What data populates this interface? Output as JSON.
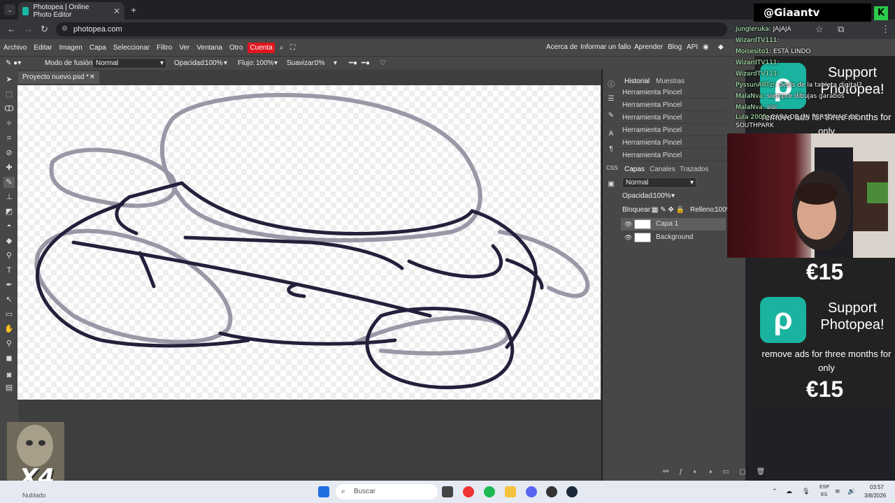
{
  "browser": {
    "tab_title": "Photopea | Online Photo Editor",
    "tab_close": "✕",
    "new_tab": "+",
    "url": "photopea.com"
  },
  "menu": {
    "items": [
      "Archivo",
      "Editar",
      "Imagen",
      "Capa",
      "Seleccionar",
      "Filtro",
      "Ver",
      "Ventana",
      "Otro"
    ],
    "account": "Cuenta",
    "right_items": [
      "Acerca de",
      "Informar un fallo",
      "Aprender",
      "Blog",
      "API"
    ]
  },
  "options": {
    "blend_label": "Modo de fusión:",
    "blend_value": "Normal",
    "opacity_label": "Opacidad:",
    "opacity_value": "100%",
    "flow_label": "Flujo:",
    "flow_value": "100%",
    "smooth_label": "Suavizar:",
    "smooth_value": "0%"
  },
  "document": {
    "tab_name": "Proyecto nuevo.psd *",
    "close": "✕"
  },
  "history": {
    "tabs": [
      "Historial",
      "Muestras"
    ],
    "items": [
      "Herramienta Pincel",
      "Herramienta Pincel",
      "Herramienta Pincel",
      "Herramienta Pincel",
      "Herramienta Pincel",
      "Herramienta Pincel"
    ]
  },
  "layers": {
    "tabs": [
      "Capas",
      "Canales",
      "Trazados"
    ],
    "blend": "Normal",
    "opacity_label": "Opacidad:",
    "opacity_value": "100%",
    "lock_label": "Bloquear:",
    "fill_label": "Relleno:",
    "fill_value": "100%",
    "items": [
      {
        "name": "Capa 1",
        "active": true
      },
      {
        "name": "Background",
        "active": false
      }
    ]
  },
  "stream": {
    "handle": "@Giaantv",
    "chat": [
      {
        "user": "jungleruka:",
        "msg": "JAJAJA"
      },
      {
        "user": "WizardTV111:",
        "msg": ""
      },
      {
        "user": "Moisesito1:",
        "msg": "ESTÁ LINDO"
      },
      {
        "user": "WizardTV111:",
        "msg": ""
      },
      {
        "user": "WizardTV111:",
        "msg": ""
      },
      {
        "user": "PyssunARTzi:",
        "msg": "decis de la tableta digital?"
      },
      {
        "user": "MalaNva:",
        "msg": "siempre dibujas garabos"
      },
      {
        "user": "MalaNva:",
        "msg": "sisi"
      },
      {
        "user": "Lula 2005:",
        "msg": "CARA DE UN PERSONAJE DE SOUTHPARK"
      }
    ],
    "ad": {
      "title": "Support Photopea!",
      "sub": "remove ads for three months for only",
      "price": "€15"
    },
    "corner_label": "X4",
    "weather": "Nublado"
  },
  "taskbar": {
    "search": "Buscar",
    "lang1": "ESP",
    "lang2": "ES",
    "time": "03:57",
    "date": "3/8/2026"
  }
}
